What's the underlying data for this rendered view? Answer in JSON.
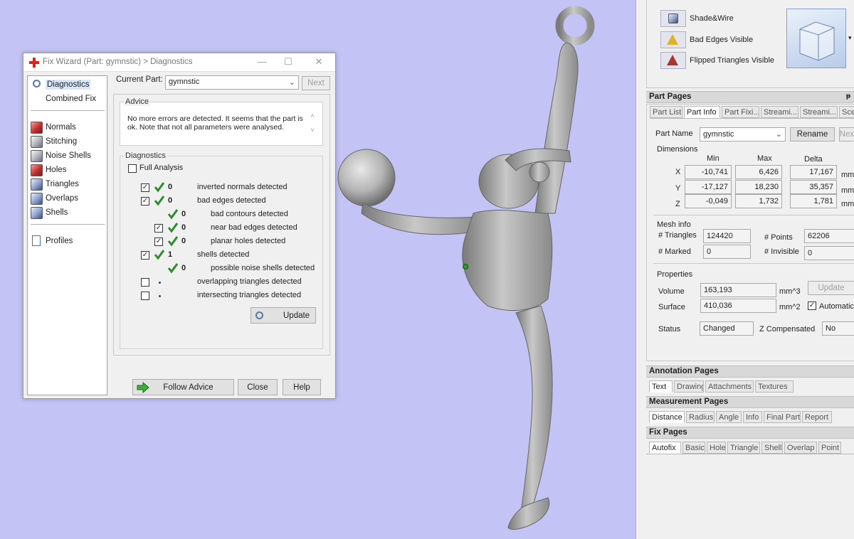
{
  "dialog": {
    "title": "Fix Wizard (Part: gymnstic) > Diagnostics",
    "sidebar": [
      {
        "label": "Diagnostics",
        "icon": "magnifier-icon"
      },
      {
        "label": "Combined Fix",
        "icon": "none"
      },
      {
        "label": "Normals",
        "icon": "normals-cube-icon"
      },
      {
        "label": "Stitching",
        "icon": "stitching-cube-icon"
      },
      {
        "label": "Noise Shells",
        "icon": "noise-shells-icon"
      },
      {
        "label": "Holes",
        "icon": "holes-cube-icon"
      },
      {
        "label": "Triangles",
        "icon": "triangles-cube-icon"
      },
      {
        "label": "Overlaps",
        "icon": "overlaps-cube-icon"
      },
      {
        "label": "Shells",
        "icon": "shells-cube-icon"
      },
      {
        "label": "Profiles",
        "icon": "document-icon"
      }
    ],
    "current_part_label": "Current Part:",
    "current_part_value": "gymnstic",
    "next_label": "Next",
    "advice_title": "Advice",
    "advice_text": "No more errors are detected. It seems that the part is ok. Note that not all parameters were analysed.",
    "diagnostics_title": "Diagnostics",
    "full_analysis_label": "Full Analysis",
    "rows": [
      {
        "checkbox": "checked",
        "status": "ok",
        "count": "0",
        "label": "inverted normals detected"
      },
      {
        "checkbox": "checked",
        "status": "ok",
        "count": "0",
        "label": "bad edges detected"
      },
      {
        "checkbox": "none",
        "status": "ok",
        "count": "0",
        "label": "bad contours detected"
      },
      {
        "checkbox": "checked",
        "status": "ok",
        "count": "0",
        "label": "near bad edges detected"
      },
      {
        "checkbox": "checked",
        "status": "ok",
        "count": "0",
        "label": "planar holes detected"
      },
      {
        "checkbox": "checked",
        "status": "ok",
        "count": "1",
        "label": "shells detected"
      },
      {
        "checkbox": "none",
        "status": "ok",
        "count": "0",
        "label": "possible noise shells detected"
      },
      {
        "checkbox": "unchecked",
        "status": "dot",
        "count": "",
        "label": "overlapping triangles detected"
      },
      {
        "checkbox": "unchecked",
        "status": "dot",
        "count": "",
        "label": "intersecting triangles detected"
      }
    ],
    "update_label": "Update",
    "follow_advice_label": "Follow Advice",
    "close_label": "Close",
    "help_label": "Help"
  },
  "view_panel": {
    "shade_wire": "Shade&Wire",
    "bad_edges_visible": "Bad Edges Visible",
    "flipped_triangles_visible": "Flipped Triangles Visible"
  },
  "part_pages": {
    "header": "Part Pages",
    "pin": "ᵽ",
    "tabs": [
      "Part List",
      "Part Info",
      "Part Fixi...",
      "Streami...",
      "Streami...",
      "Scen"
    ],
    "part_name_label": "Part Name",
    "part_name_value": "gymnstic",
    "rename_label": "Rename",
    "next_label": "Nex",
    "dimensions_title": "Dimensions",
    "col_min": "Min",
    "col_max": "Max",
    "col_delta": "Delta",
    "rows": [
      {
        "axis": "X",
        "min": "-10,741",
        "max": "6,426",
        "delta": "17,167",
        "unit": "mm"
      },
      {
        "axis": "Y",
        "min": "-17,127",
        "max": "18,230",
        "delta": "35,357",
        "unit": "mm"
      },
      {
        "axis": "Z",
        "min": "-0,049",
        "max": "1,732",
        "delta": "1,781",
        "unit": "mm"
      }
    ],
    "mesh_info_title": "Mesh info",
    "triangles_label": "# Triangles",
    "triangles_value": "124420",
    "points_label": "# Points",
    "points_value": "62206",
    "marked_label": "# Marked",
    "marked_value": "0",
    "invisible_label": "# Invisible",
    "invisible_value": "0",
    "properties_title": "Properties",
    "volume_label": "Volume",
    "volume_value": "163,193",
    "volume_unit": "mm^3",
    "surface_label": "Surface",
    "surface_value": "410,036",
    "surface_unit": "mm^2",
    "update_label": "Update",
    "automatic_label": "Automatic",
    "status_label": "Status",
    "status_value": "Changed",
    "zcomp_label": "Z Compensated",
    "zcomp_value": "No"
  },
  "annotation_pages": {
    "header": "Annotation Pages",
    "tabs": [
      "Text",
      "Drawing",
      "Attachments",
      "Textures"
    ]
  },
  "measurement_pages": {
    "header": "Measurement Pages",
    "tabs": [
      "Distance",
      "Radius",
      "Angle",
      "Info",
      "Final Part",
      "Report"
    ]
  },
  "fix_pages": {
    "header": "Fix Pages",
    "tabs": [
      "Autofix",
      "Basic",
      "Hole",
      "Triangle",
      "Shell",
      "Overlap",
      "Point"
    ]
  }
}
